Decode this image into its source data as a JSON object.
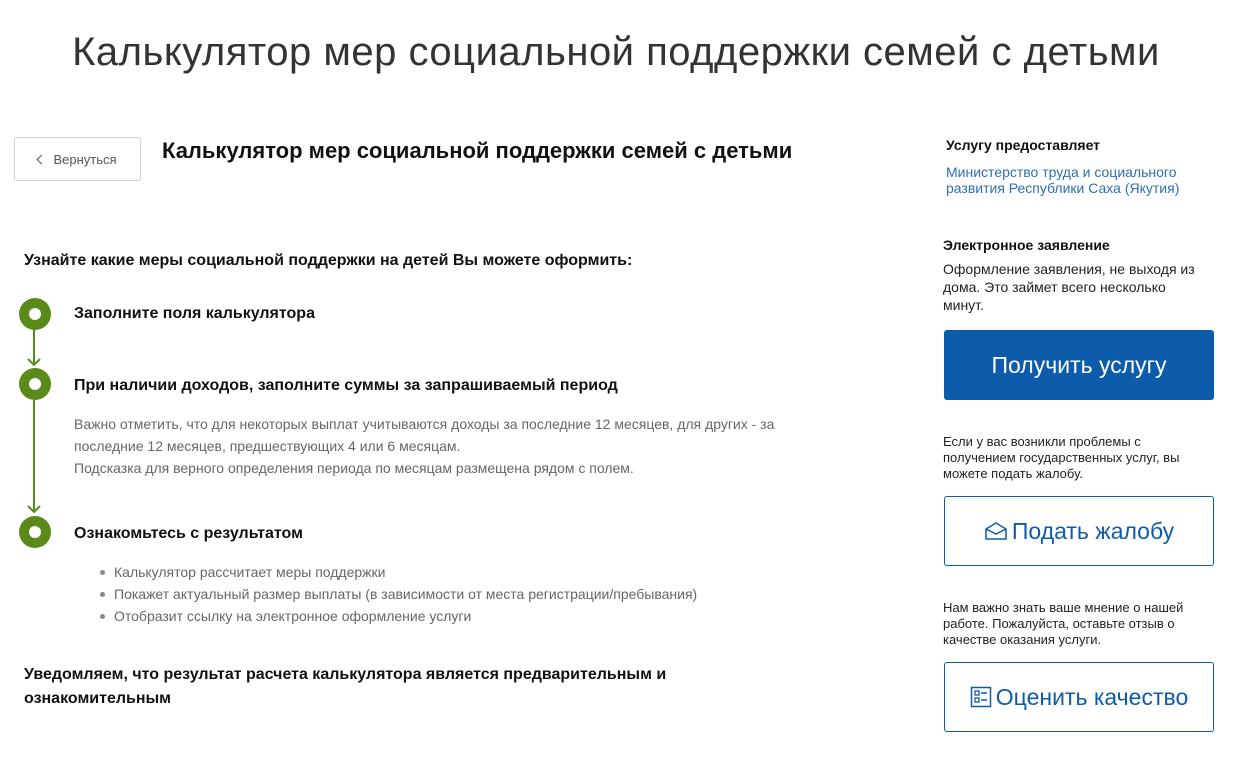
{
  "header": {
    "title": "Калькулятор мер социальной поддержки семей с детьми"
  },
  "nav": {
    "back_label": "Вернуться",
    "back_icon": "chevron-left-icon"
  },
  "service": {
    "title": "Калькулятор мер социальной поддержки семей с детьми"
  },
  "intro": "Узнайте какие меры социальной поддержки на детей Вы можете оформить:",
  "steps": [
    {
      "title": "Заполните поля калькулятора"
    },
    {
      "title": "При наличии доходов, заполните суммы за запрашиваемый период",
      "desc_line1": "Важно отметить, что для некоторых выплат учитываются доходы за последние 12 месяцев, для других - за",
      "desc_line2": "последние 12 месяцев, предшествующих 4 или 6 месяцам.",
      "desc_line3": "Подсказка для верного определения периода по месяцам размещена рядом с полем."
    },
    {
      "title": "Ознакомьтесь с результатом",
      "items": [
        "Калькулятор рассчитает меры поддержки",
        "Покажет актуальный размер выплаты (в зависимости от места регистрации/пребывания)",
        "Отобразит ссылку на электронное оформление услуги"
      ]
    }
  ],
  "notice_line1": "Уведомляем, что результат расчета калькулятора является предварительным и",
  "notice_line2": "ознакомительным",
  "sidebar": {
    "provider_heading": "Услугу предоставляет",
    "provider_line1": "Министерство труда и социального",
    "provider_line2": "развития Республики Саха (Якутия)",
    "eform_heading": "Электронное заявление",
    "eform_line1": "Оформление заявления, не выходя из",
    "eform_line2": "дома. Это займет всего несколько",
    "eform_line3": "минут.",
    "get_service_label": "Получить услугу",
    "complaint_text_line1": "Если у вас возникли проблемы с",
    "complaint_text_line2": "получением государственных услуг, вы",
    "complaint_text_line3": "можете подать жалобу.",
    "complaint_label": "Подать жалобу",
    "complaint_icon": "envelope-icon",
    "feedback_text_line1": "Нам важно знать ваше мнение о нашей",
    "feedback_text_line2": "работе. Пожалуйста, оставьте отзыв о",
    "feedback_text_line3": "качестве оказания услуги.",
    "rate_label": "Оценить качество",
    "rate_icon": "checklist-icon"
  },
  "colors": {
    "accent": "#0d5cac",
    "step_green": "#5a8a1a",
    "link": "#2f6fb3"
  }
}
